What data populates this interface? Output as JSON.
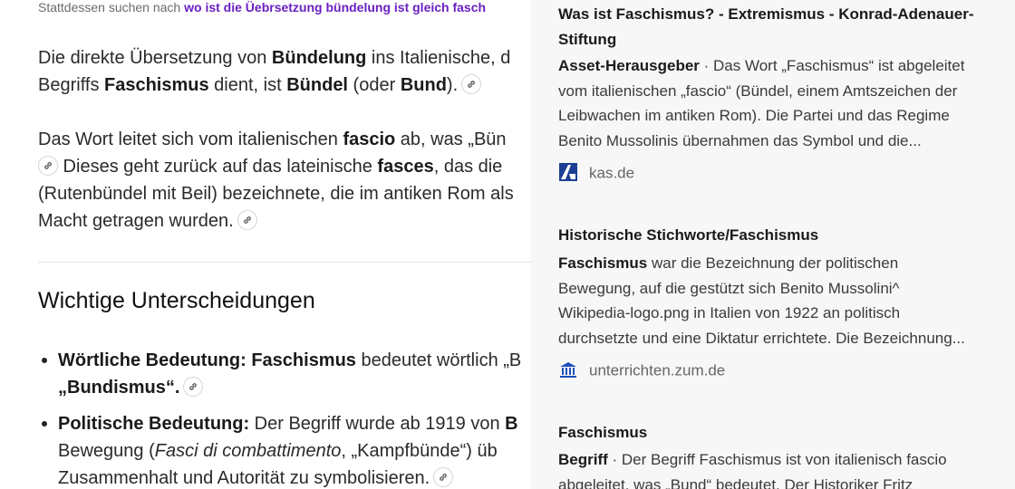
{
  "search_suggestion": {
    "prefix": "Stattdessen suchen nach",
    "query": "wo ist die Üebrsetzung bündelung ist gleich fasch"
  },
  "answer": {
    "p1": {
      "l1_a": "Die direkte Übersetzung von ",
      "l1_b": "Bündelung",
      "l1_c": " ins Italienische, d",
      "l2_a": "Begriffs ",
      "l2_b": "Faschismus",
      "l2_c": " dient, ist ",
      "l2_d": "Bündel",
      "l2_e": " (oder ",
      "l2_f": "Bund",
      "l2_g": ")."
    },
    "p2": {
      "l1_a": "Das Wort leitet sich vom italienischen ",
      "l1_b": "fascio",
      "l1_c": " ab, was „Bün",
      "l2_a": " Dieses geht zurück auf das lateinische ",
      "l2_b": "fasces",
      "l2_c": ", das die",
      "l3": "(Rutenbündel mit Beil) bezeichnete, die im antiken Rom als",
      "l4": "Macht getragen wurden."
    },
    "heading": "Wichtige Unterscheidungen",
    "b1": {
      "label": "Wörtliche Bedeutung:",
      "term": "Faschismus",
      "text": " bedeutet wörtlich „B",
      "l2": "„Bundismus“."
    },
    "b2": {
      "label": "Politische Bedeutung:",
      "text": " Der Begriff wurde ab 1919 von ",
      "text_b": "B",
      "l2_a": "Bewegung (",
      "l2_em": "Fasci di combattimento",
      "l2_b": ", „Kampfbünde“) üb",
      "l3": "Zusammenhalt und Autorität zu symbolisieren."
    }
  },
  "sources": [
    {
      "title_l1": "Was ist Faschismus? - Extremismus - Konrad-Adenauer-",
      "title_l2": "Stiftung",
      "snippet_lead": "Asset-Herausgeber",
      "snippet_l1": " · Das Wort „Faschismus“ ist abgeleitet",
      "snippet_l2": "vom italienischen „fascio“ (Bündel, einem Amtszeichen der",
      "snippet_l3": "Leibwachen im antiken Rom). Die Partei und das Regime",
      "snippet_l4": "Benito Mussolinis übernahmen das Symbol und die...",
      "domain": "kas.de",
      "favicon": "kas-logo-icon"
    },
    {
      "title_l1": "Historische Stichworte/Faschismus",
      "snippet_lead": "Faschismus",
      "snippet_l1": " war die Bezeichnung der politischen",
      "snippet_l2": "Bewegung, auf die gestützt sich Benito Mussolini^",
      "snippet_l3": "Wikipedia-logo.png in Italien von 1922 an politisch",
      "snippet_l4": "durchsetzte und eine Diktatur errichtete. Die Bezeichnung...",
      "domain": "unterrichten.zum.de",
      "favicon": "museum-icon"
    },
    {
      "title_l1": "Faschismus",
      "snippet_lead": "Begriff",
      "snippet_l1": " · Der Begriff Faschismus ist von italienisch fascio",
      "snippet_l2": "abgeleitet, was „Bund“ bedeutet. Der Historiker Fritz"
    }
  ],
  "colors": {
    "suggest_link": "#6a1fc2",
    "panel_bg": "#f7f7f7",
    "kas_blue": "#1c3f94",
    "museum_blue": "#1d4fb8"
  }
}
